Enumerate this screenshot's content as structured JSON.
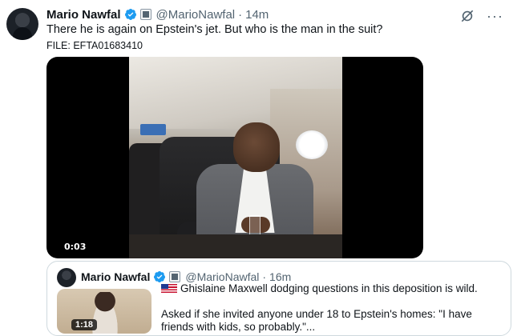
{
  "tweet": {
    "author_name": "Mario Nawfal",
    "handle": "@MarioNawfal",
    "separator": "·",
    "time": "14m",
    "text": "There he is again on Epstein's jet. But who is the man in the suit?",
    "file_line": "FILE: EFTA01683410",
    "video_timestamp": "0:03"
  },
  "quoted_tweet": {
    "author_name": "Mario Nawfal",
    "handle": "@MarioNawfal",
    "separator": "·",
    "time": "16m",
    "video_duration": "1:18",
    "line1": "Ghislaine Maxwell dodging questions in this deposition is wild.",
    "line2": "Asked if she invited anyone under 18 to Epstein's homes: \"I have friends with kids, so probably.\"..."
  },
  "icons": {
    "verified": "verified-badge-icon",
    "affiliation": "affiliation-badge-icon",
    "grok": "grok-icon",
    "more": "more-options-icon",
    "flag": "us-flag-icon"
  },
  "colors": {
    "verified": "#1d9bf0",
    "secondary_text": "#536471",
    "border": "#cfd9de"
  }
}
